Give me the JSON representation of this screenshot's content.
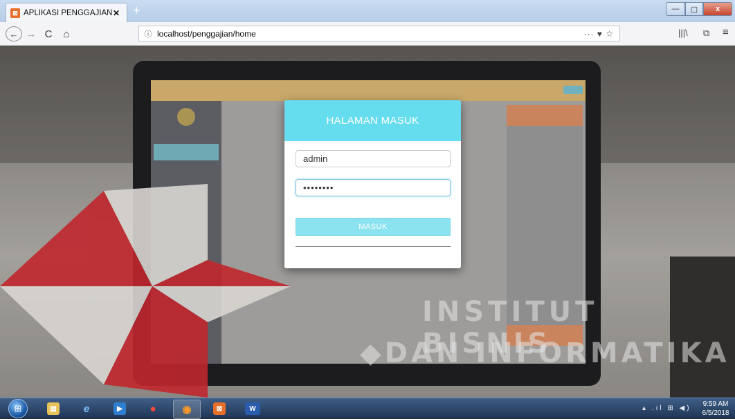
{
  "browser": {
    "tab_title": "APLIKASI PENGGAJIAN | LOGIN",
    "tab_close": "✕",
    "new_tab": "+",
    "url": "localhost/penggajian/home",
    "url_info_icon": "ⓘ",
    "url_actions": "··· ♥ ☆",
    "toolbar_right": [
      "|||\\",
      "⧉",
      "≡"
    ],
    "window_controls": {
      "minimize": "—",
      "maximize": "▢",
      "close": "x"
    },
    "nav": {
      "back": "←",
      "forward": "→",
      "reload": "C",
      "home": "⌂"
    }
  },
  "login": {
    "title": "HALAMAN MASUK",
    "username_value": "admin",
    "password_value": "••••••••",
    "submit_label": "MASUK"
  },
  "watermark": {
    "line1": "INSTITUT BISNIS",
    "line2": "DAN INFORMATIKA"
  },
  "taskbar": {
    "apps": [
      "windows-explorer",
      "internet-explorer",
      "media-player",
      "app",
      "firefox",
      "xampp",
      "word"
    ],
    "word_label": "W",
    "tray_icons": "▴ .ıl ⊞ ◀)",
    "clock_time": "9:59 AM",
    "clock_date": "6/5/2018"
  },
  "colors": {
    "modal_header": "#66dcef",
    "submit_button": "#8be3ef",
    "logo_red": "#c0272d",
    "taskbar": "#2a4670"
  }
}
